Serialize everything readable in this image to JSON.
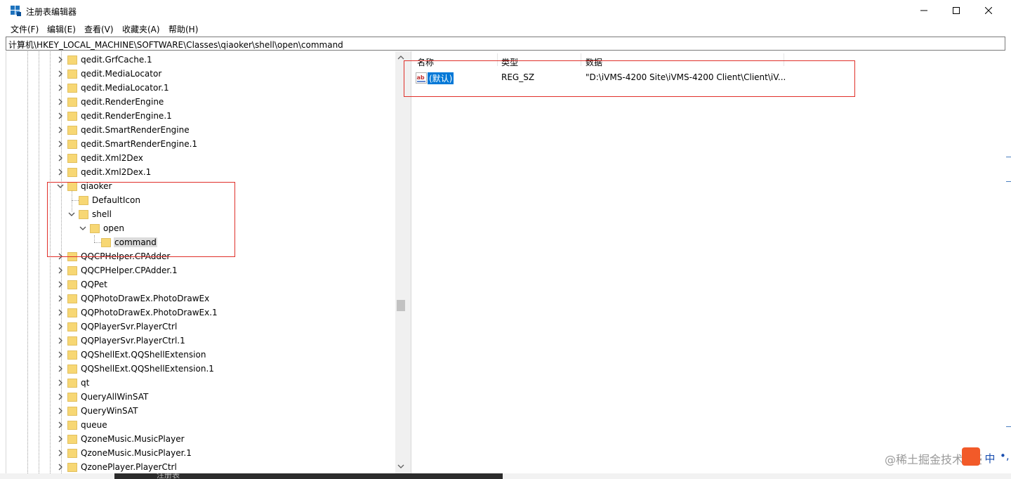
{
  "window": {
    "title": "注册表编辑器"
  },
  "menu": [
    "文件(F)",
    "编辑(E)",
    "查看(V)",
    "收藏夹(A)",
    "帮助(H)"
  ],
  "address": "计算机\\HKEY_LOCAL_MACHINE\\SOFTWARE\\Classes\\qiaoker\\shell\\open\\command",
  "tree": {
    "items": [
      {
        "label": "qedit.GrfCache.1",
        "level": 0,
        "expander": "right"
      },
      {
        "label": "qedit.MediaLocator",
        "level": 0,
        "expander": "right"
      },
      {
        "label": "qedit.MediaLocator.1",
        "level": 0,
        "expander": "right"
      },
      {
        "label": "qedit.RenderEngine",
        "level": 0,
        "expander": "right"
      },
      {
        "label": "qedit.RenderEngine.1",
        "level": 0,
        "expander": "right"
      },
      {
        "label": "qedit.SmartRenderEngine",
        "level": 0,
        "expander": "right"
      },
      {
        "label": "qedit.SmartRenderEngine.1",
        "level": 0,
        "expander": "right"
      },
      {
        "label": "qedit.Xml2Dex",
        "level": 0,
        "expander": "right"
      },
      {
        "label": "qedit.Xml2Dex.1",
        "level": 0,
        "expander": "right"
      },
      {
        "label": "qiaoker",
        "level": 0,
        "expander": "down"
      },
      {
        "label": "DefaultIcon",
        "level": 1,
        "expander": "none"
      },
      {
        "label": "shell",
        "level": 1,
        "expander": "down"
      },
      {
        "label": "open",
        "level": 2,
        "expander": "down"
      },
      {
        "label": "command",
        "level": 3,
        "expander": "none",
        "selected": true
      },
      {
        "label": "QQCPHelper.CPAdder",
        "level": 0,
        "expander": "right"
      },
      {
        "label": "QQCPHelper.CPAdder.1",
        "level": 0,
        "expander": "right"
      },
      {
        "label": "QQPet",
        "level": 0,
        "expander": "right"
      },
      {
        "label": "QQPhotoDrawEx.PhotoDrawEx",
        "level": 0,
        "expander": "right"
      },
      {
        "label": "QQPhotoDrawEx.PhotoDrawEx.1",
        "level": 0,
        "expander": "right"
      },
      {
        "label": "QQPlayerSvr.PlayerCtrl",
        "level": 0,
        "expander": "right"
      },
      {
        "label": "QQPlayerSvr.PlayerCtrl.1",
        "level": 0,
        "expander": "right"
      },
      {
        "label": "QQShellExt.QQShellExtension",
        "level": 0,
        "expander": "right"
      },
      {
        "label": "QQShellExt.QQShellExtension.1",
        "level": 0,
        "expander": "right"
      },
      {
        "label": "qt",
        "level": 0,
        "expander": "right"
      },
      {
        "label": "QueryAllWinSAT",
        "level": 0,
        "expander": "right"
      },
      {
        "label": "QueryWinSAT",
        "level": 0,
        "expander": "right"
      },
      {
        "label": "queue",
        "level": 0,
        "expander": "right"
      },
      {
        "label": "QzoneMusic.MusicPlayer",
        "level": 0,
        "expander": "right"
      },
      {
        "label": "QzoneMusic.MusicPlayer.1",
        "level": 0,
        "expander": "right"
      },
      {
        "label": "QzonePlayer.PlayerCtrl",
        "level": 0,
        "expander": "right"
      }
    ]
  },
  "list": {
    "columns": [
      "名称",
      "类型",
      "数据"
    ],
    "rows": [
      {
        "name": "(默认)",
        "type": "REG_SZ",
        "data": "\"D:\\iVMS-4200 Site\\iVMS-4200 Client\\Client\\iV..."
      }
    ]
  },
  "value_icon_text": "ab",
  "taskbar": {
    "text": "注册表"
  },
  "watermark": "@稀土掘金技术社区",
  "ime": {
    "label": "中",
    "dots": "•,"
  },
  "colors": {
    "folder": "#f7d774",
    "folder_edge": "#dcb64a",
    "selection": "#0078d7",
    "annotation": "#e0302a",
    "icon_blue": "#1e73be"
  },
  "icons": [
    "registry-app-icon",
    "minimize-icon",
    "maximize-icon",
    "close-icon",
    "chevron-right-icon",
    "chevron-down-icon",
    "folder-icon",
    "string-value-icon"
  ]
}
